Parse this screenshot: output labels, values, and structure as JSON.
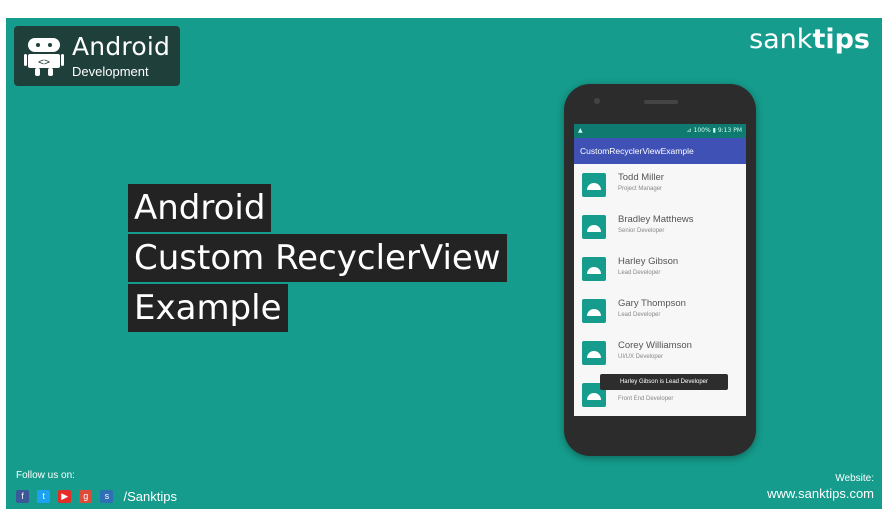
{
  "logo": {
    "title": "Android",
    "subtitle": "Development",
    "icon": "android-robot-icon"
  },
  "brand": {
    "part1": "sank",
    "part2": "tips"
  },
  "title_lines": [
    "Android",
    "Custom RecyclerView",
    "Example"
  ],
  "phone": {
    "status_left": "▲",
    "status_right": "⊿ 100% ▮ 9:13 PM",
    "app_title": "CustomRecyclerViewExample",
    "contacts": [
      {
        "name": "Todd Miller",
        "role": "Project Manager"
      },
      {
        "name": "Bradley Matthews",
        "role": "Senior Developer"
      },
      {
        "name": "Harley Gibson",
        "role": "Lead Developer"
      },
      {
        "name": "Gary Thompson",
        "role": "Lead Developer"
      },
      {
        "name": "Corey Williamson",
        "role": "UI/UX Developer"
      },
      {
        "name": "",
        "role": "Front End Developer"
      }
    ],
    "toast": "Harley Gibson is Lead Developer"
  },
  "footer": {
    "follow_label": "Follow us on:",
    "social_icons": [
      "facebook-icon",
      "twitter-icon",
      "youtube-icon",
      "google-plus-icon",
      "sanktips-icon"
    ],
    "handle": "/Sanktips",
    "website_label": "Website:",
    "website_url": "www.sanktips.com"
  },
  "colors": {
    "background": "#159c8c",
    "title_block": "#232323",
    "app_bar": "#3f51b5",
    "facebook": "#3b5998",
    "twitter": "#1da1f2",
    "youtube": "#e52d27",
    "google_plus": "#dd4b39"
  }
}
